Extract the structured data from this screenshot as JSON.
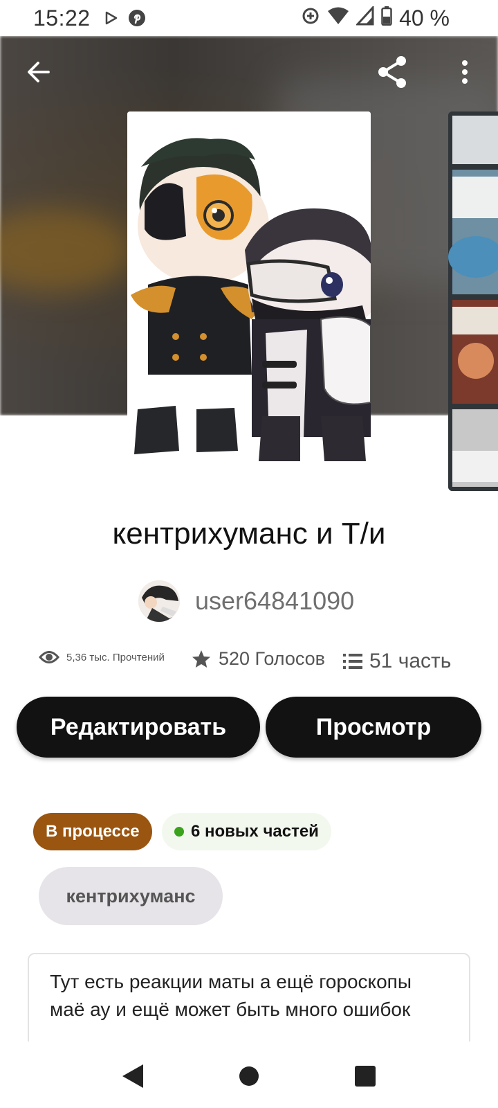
{
  "status_bar": {
    "time": "15:22",
    "battery": "40 %",
    "icons": [
      "play-store-icon",
      "pinterest-icon",
      "data-saver-icon",
      "wifi-icon",
      "signal-icon",
      "battery-icon"
    ]
  },
  "top_bar": {
    "icons": [
      "back-arrow-icon",
      "share-icon",
      "more-vertical-icon"
    ]
  },
  "story": {
    "title": "кентрихуманс и Т/и",
    "author": "user64841090",
    "reads": "5,36 тыс. Прочтений",
    "votes": "520 Голосов",
    "parts": "51 часть"
  },
  "actions": {
    "edit_label": "Редактировать",
    "view_label": "Просмотр"
  },
  "status": {
    "progress_label": "В процессе",
    "new_parts_label": "6 новых частей"
  },
  "tags": [
    "кентрихуманс"
  ],
  "description": "Тут есть реакции маты а ещё гороскопы маё ау и ещё может быть  много ошибок",
  "colors": {
    "primary_button": "#121212",
    "progress_badge": "#9a5510",
    "new_dot": "#3aa21d",
    "tag_bg": "#e6e4e8"
  },
  "nav_bar": {
    "icons": [
      "nav-back-icon",
      "nav-home-icon",
      "nav-recents-icon"
    ]
  }
}
